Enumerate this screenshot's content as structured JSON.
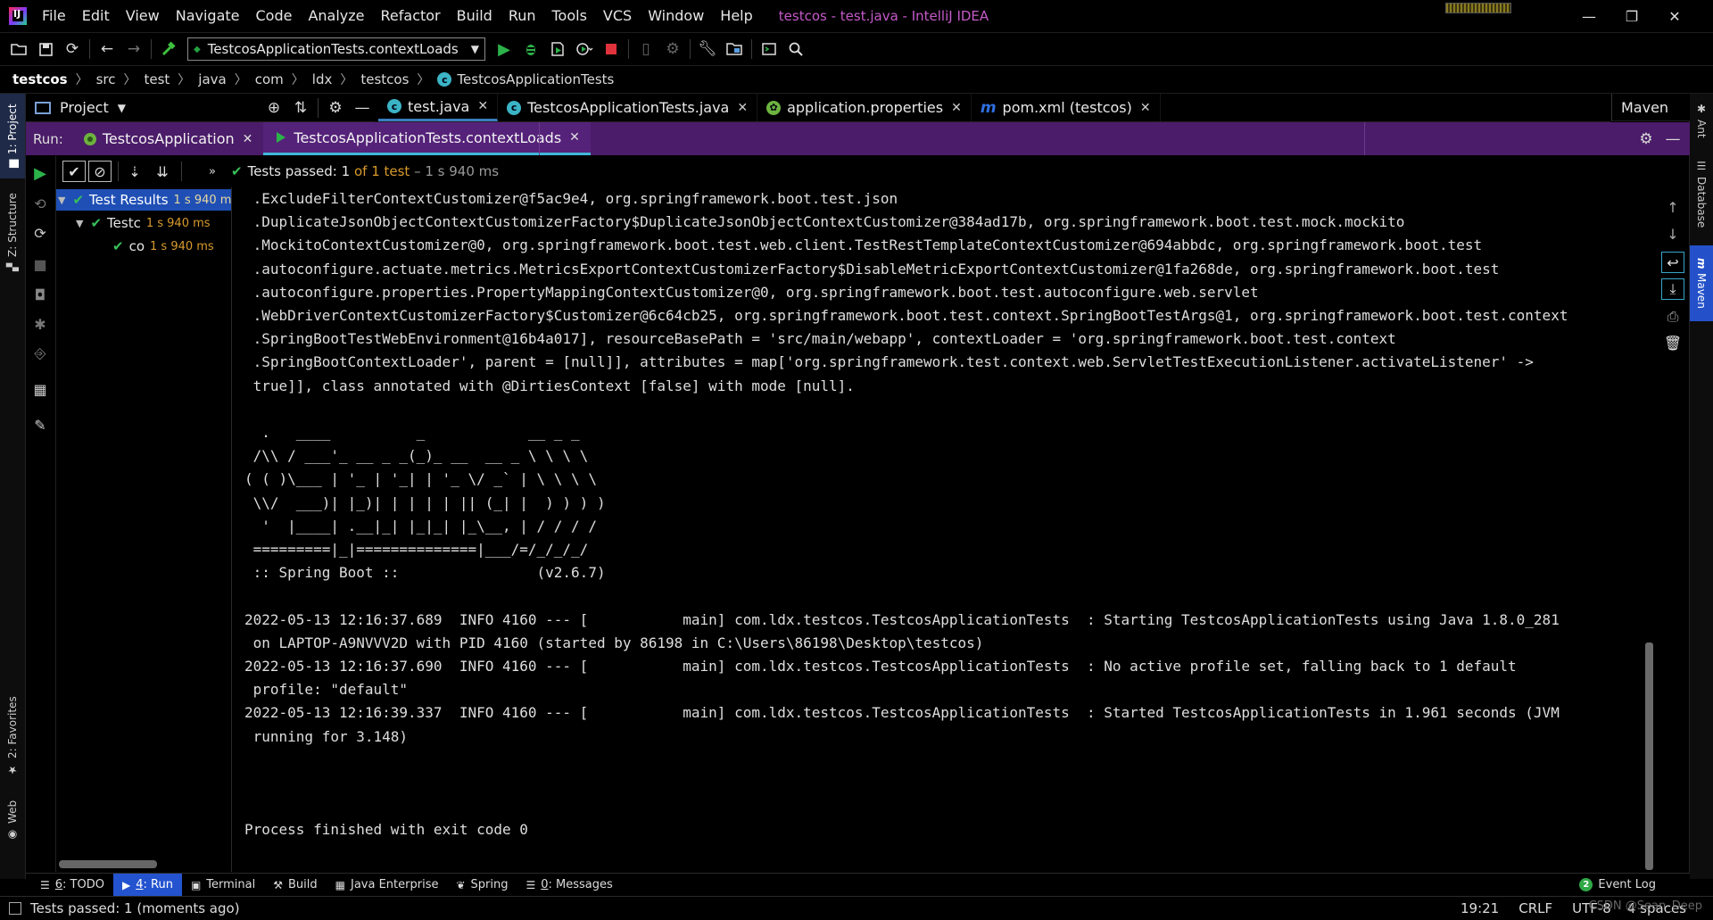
{
  "app": {
    "logo_text": "IJ",
    "window_title": "testcos - test.java - IntelliJ IDEA",
    "menu": [
      "File",
      "Edit",
      "View",
      "Navigate",
      "Code",
      "Analyze",
      "Refactor",
      "Build",
      "Run",
      "Tools",
      "VCS",
      "Window",
      "Help"
    ],
    "window_controls": {
      "minimize": "—",
      "restore": "❐",
      "close": "✕"
    }
  },
  "toolbar": {
    "run_config": "TestcosApplicationTests.contextLoads"
  },
  "breadcrumbs": [
    "testcos",
    "src",
    "test",
    "java",
    "com",
    "ldx",
    "testcos",
    "TestcosApplicationTests"
  ],
  "project_panel": {
    "title": "Project"
  },
  "editor_tabs": [
    {
      "label": "test.java",
      "icon": "c",
      "color": "#3bb4c6",
      "active": true
    },
    {
      "label": "TestcosApplicationTests.java",
      "icon": "c",
      "color": "#3bb4c6",
      "active": false
    },
    {
      "label": "application.properties",
      "icon": "leaf",
      "color": "#6db33f",
      "active": false
    },
    {
      "label": "pom.xml (testcos)",
      "icon": "m",
      "color": "#2f6fe0",
      "active": false
    }
  ],
  "maven_tab": "Maven",
  "left_stripe": {
    "project": "1: Project",
    "structure": "Z: Structure",
    "favorites": "2: Favorites",
    "web": "Web"
  },
  "right_stripe": {
    "ant": "Ant",
    "database": "Database",
    "maven": "Maven"
  },
  "run_bar": {
    "label": "Run:",
    "tabs": [
      {
        "label": "TestcosApplication",
        "active": false
      },
      {
        "label": "TestcosApplicationTests.contextLoads",
        "active": true
      }
    ]
  },
  "run_toolbar": {
    "passed_prefix": "Tests passed:",
    "passed_count": "1",
    "passed_of": "of 1 test",
    "passed_time": "– 1 s 940 ms"
  },
  "test_tree": [
    {
      "label": "Test Results",
      "time": "1 s 940 ms",
      "level": 0,
      "selected": true,
      "expander": "▼"
    },
    {
      "label": "Testc",
      "time": "1 s 940 ms",
      "level": 1,
      "selected": false,
      "expander": "▼"
    },
    {
      "label": "co",
      "time": "1 s 940 ms",
      "level": 2,
      "selected": false,
      "expander": ""
    }
  ],
  "console_lines": [
    " .ExcludeFilterContextCustomizer@f5ac9e4, org.springframework.boot.test.json",
    " .DuplicateJsonObjectContextCustomizerFactory$DuplicateJsonObjectContextCustomizer@384ad17b, org.springframework.boot.test.mock.mockito",
    " .MockitoContextCustomizer@0, org.springframework.boot.test.web.client.TestRestTemplateContextCustomizer@694abbdc, org.springframework.boot.test",
    " .autoconfigure.actuate.metrics.MetricsExportContextCustomizerFactory$DisableMetricExportContextCustomizer@1fa268de, org.springframework.boot.test",
    " .autoconfigure.properties.PropertyMappingContextCustomizer@0, org.springframework.boot.test.autoconfigure.web.servlet",
    " .WebDriverContextCustomizerFactory$Customizer@6c64cb25, org.springframework.boot.test.context.SpringBootTestArgs@1, org.springframework.boot.test.context",
    " .SpringBootTestWebEnvironment@16b4a017], resourceBasePath = 'src/main/webapp', contextLoader = 'org.springframework.boot.test.context",
    " .SpringBootContextLoader', parent = [null]], attributes = map['org.springframework.test.context.web.ServletTestExecutionListener.activateListener' ->",
    " true]], class annotated with @DirtiesContext [false] with mode [null].",
    "",
    "  .   ____          _            __ _ _",
    " /\\\\ / ___'_ __ _ _(_)_ __  __ _ \\ \\ \\ \\",
    "( ( )\\___ | '_ | '_| | '_ \\/ _` | \\ \\ \\ \\",
    " \\\\/  ___)| |_)| | | | | || (_| |  ) ) ) )",
    "  '  |____| .__|_| |_|_| |_\\__, | / / / /",
    " =========|_|==============|___/=/_/_/_/",
    " :: Spring Boot ::                (v2.6.7)",
    "",
    "2022-05-13 12:16:37.689  INFO 4160 --- [           main] com.ldx.testcos.TestcosApplicationTests  : Starting TestcosApplicationTests using Java 1.8.0_281",
    " on LAPTOP-A9NVVV2D with PID 4160 (started by 86198 in C:\\Users\\86198\\Desktop\\testcos)",
    "2022-05-13 12:16:37.690  INFO 4160 --- [           main] com.ldx.testcos.TestcosApplicationTests  : No active profile set, falling back to 1 default",
    " profile: \"default\"",
    "2022-05-13 12:16:39.337  INFO 4160 --- [           main] com.ldx.testcos.TestcosApplicationTests  : Started TestcosApplicationTests in 1.961 seconds (JVM",
    " running for 3.148)",
    "",
    "",
    "",
    "Process finished with exit code 0"
  ],
  "tool_tabs": [
    {
      "mn": "6",
      "label": ": TODO",
      "icon": "☰",
      "active": false
    },
    {
      "mn": "4",
      "label": ": Run",
      "icon": "▶",
      "active": true
    },
    {
      "mn": "",
      "label": "Terminal",
      "icon": "▣",
      "active": false
    },
    {
      "mn": "",
      "label": "Build",
      "icon": "⚒",
      "active": false
    },
    {
      "mn": "",
      "label": "Java Enterprise",
      "icon": "▦",
      "active": false
    },
    {
      "mn": "",
      "label": "Spring",
      "icon": "❦",
      "active": false
    },
    {
      "mn": "0",
      "label": ": Messages",
      "icon": "☰",
      "active": false
    }
  ],
  "event_log": {
    "badge": "2",
    "label": "Event Log"
  },
  "status_bar": {
    "message": "Tests passed: 1 (moments ago)",
    "position": "19:21",
    "line_sep": "CRLF",
    "encoding": "UTF-8",
    "indent": "4 spaces",
    "watermark": "CSDN @Sean_Deep"
  },
  "colors": {
    "run_bar": "#4b1c69",
    "selection": "#1f4fb5",
    "pass_green": "#38c05a",
    "time_orange": "#d89a2c",
    "active_tool_tab": "#2453cf",
    "title_magenta": "#c45ac8"
  }
}
